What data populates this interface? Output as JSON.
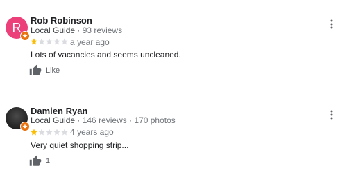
{
  "reviews": [
    {
      "avatar_letter": "R",
      "avatar_color": "#ec407a",
      "name": "Rob Robinson",
      "guide_label": "Local Guide",
      "guide_stats": " · 93 reviews",
      "rating": 1,
      "rating_max": 5,
      "time": "a year ago",
      "text": "Lots of vacancies and seems uncleaned.",
      "like_label": "Like"
    },
    {
      "avatar_letter": "",
      "avatar_color": "#2a2a2a",
      "name": "Damien Ryan",
      "guide_label": "Local Guide",
      "guide_stats": " · 146 reviews · 170 photos",
      "rating": 1,
      "rating_max": 5,
      "time": "4 years ago",
      "text": "Very quiet shopping strip...",
      "like_label": "1"
    }
  ],
  "colors": {
    "star_filled": "#fbbc04",
    "star_empty": "#dadce0",
    "guide_badge": "#e8710a",
    "divider": "#e8eaed"
  },
  "icons": {
    "like": "thumb-up-icon",
    "more": "more-vert-icon",
    "badge": "local-guide-badge-icon"
  }
}
